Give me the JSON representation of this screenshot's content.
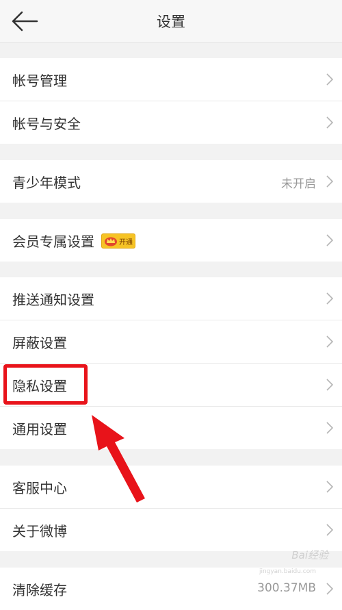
{
  "header": {
    "title": "设置"
  },
  "groups": [
    {
      "rows": [
        {
          "label": "帐号管理"
        },
        {
          "label": "帐号与安全"
        }
      ]
    },
    {
      "rows": [
        {
          "label": "青少年模式",
          "value": "未开启"
        }
      ]
    },
    {
      "rows": [
        {
          "label": "会员专属设置",
          "badge": "开通"
        }
      ]
    },
    {
      "rows": [
        {
          "label": "推送通知设置"
        },
        {
          "label": "屏蔽设置"
        },
        {
          "label": "隐私设置"
        },
        {
          "label": "通用设置"
        }
      ]
    },
    {
      "rows": [
        {
          "label": "客服中心"
        },
        {
          "label": "关于微博"
        }
      ]
    },
    {
      "rows": [
        {
          "label": "清除缓存",
          "value": "300.37MB"
        }
      ]
    }
  ],
  "annotation": {
    "highlight_color": "#e8131a"
  },
  "watermark": {
    "text": "Bai经验",
    "url": "jingyan.baidu.com"
  },
  "colors": {
    "background": "#f2f2f2",
    "row_bg": "#ffffff",
    "text": "#333333",
    "secondary_text": "#999999"
  },
  "icons": {
    "back": "arrow-left-icon",
    "chevron": "chevron-right-icon",
    "vip": "crown-icon"
  }
}
